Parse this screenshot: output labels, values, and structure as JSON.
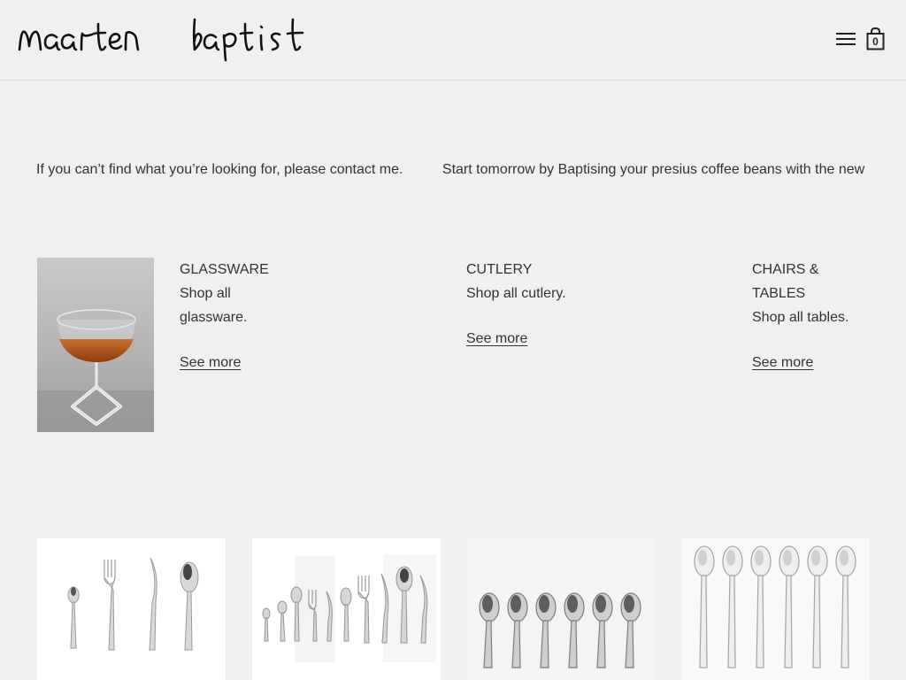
{
  "brand": {
    "logo_text": "maarten baptist"
  },
  "header": {
    "cart_count": "0"
  },
  "ticker": [
    "If you can’t find what you’re looking for, please contact me.",
    "Start tomorrow by Baptising your presius coffee beans with the new"
  ],
  "categories": [
    {
      "title": "GLASSWARE",
      "desc": "Shop all glassware.",
      "more": "See more"
    },
    {
      "title": "CUTLERY",
      "desc": "Shop all cutlery.",
      "more": "See more"
    },
    {
      "title": "CHAIRS & TABLES",
      "desc": "Shop all tables.",
      "more": "See more"
    }
  ],
  "products": [
    {
      "image": "cutlery-four-piece-set"
    },
    {
      "image": "cutlery-full-set"
    },
    {
      "image": "espresso-spoons-six"
    },
    {
      "image": "long-spoons-six"
    }
  ],
  "colors": {
    "background": "#f0f0f0",
    "text": "#333333",
    "card": "#ffffff"
  }
}
